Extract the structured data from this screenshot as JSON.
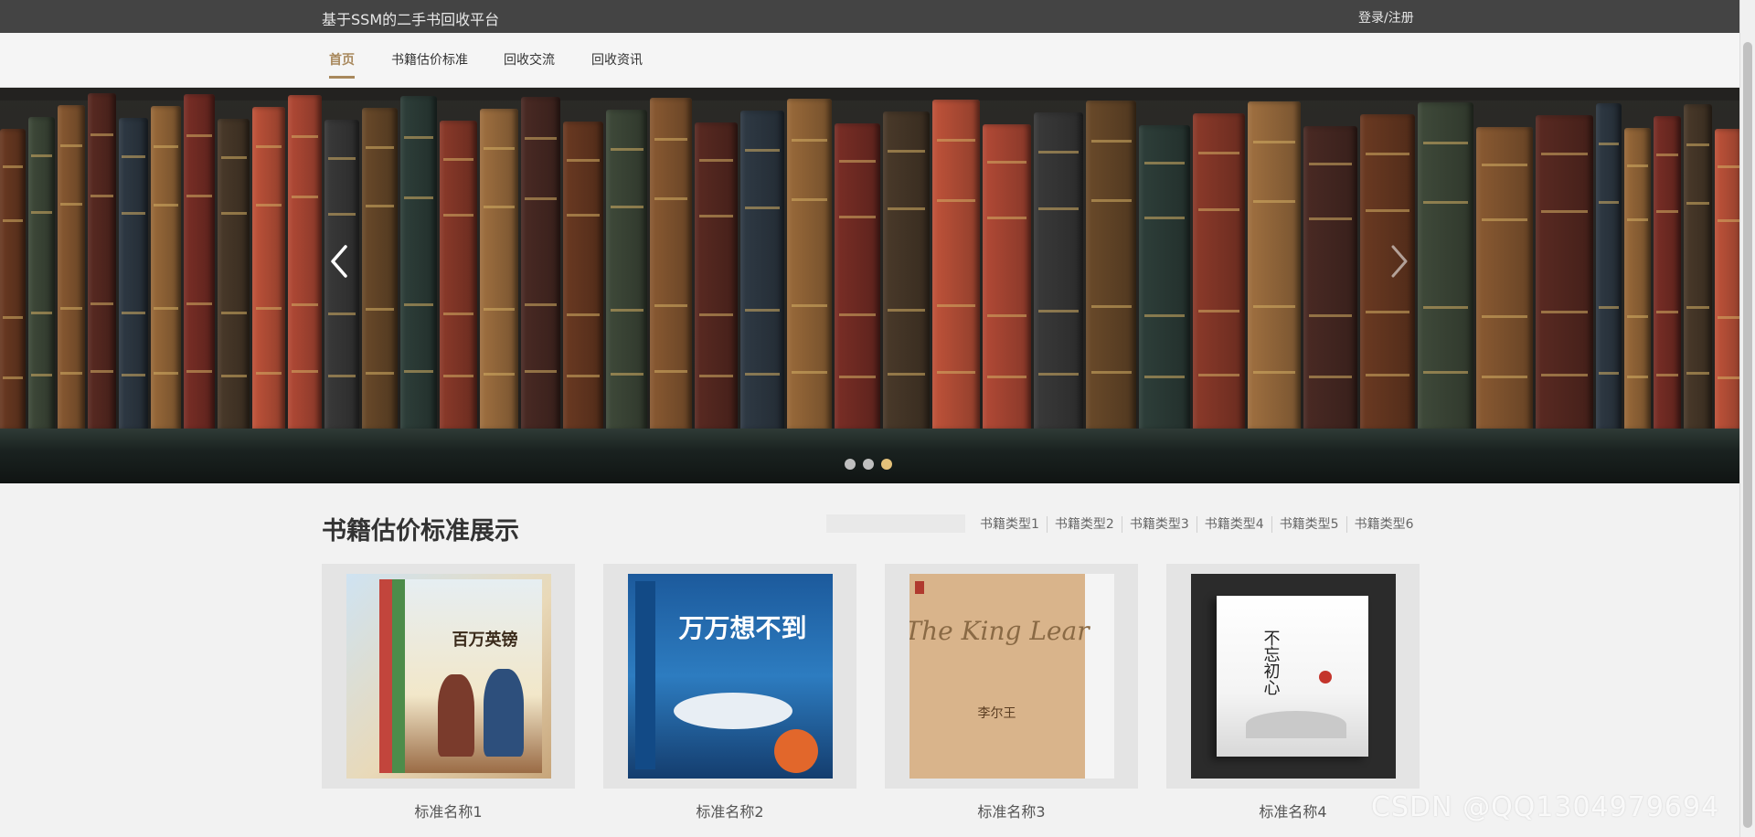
{
  "header": {
    "site_title": "基于SSM的二手书回收平台",
    "login_label": "登录/注册"
  },
  "nav": {
    "items": [
      {
        "label": "首页",
        "active": true
      },
      {
        "label": "书籍估价标准",
        "active": false
      },
      {
        "label": "回收交流",
        "active": false
      },
      {
        "label": "回收资讯",
        "active": false
      }
    ]
  },
  "banner": {
    "icons": {
      "prev": "chevron-left-icon",
      "next": "chevron-right-icon"
    },
    "slides": 3,
    "active_slide": 3
  },
  "section": {
    "title": "书籍估价标准展示",
    "categories": [
      "书籍类型1",
      "书籍类型2",
      "书籍类型3",
      "书籍类型4",
      "书籍类型5",
      "书籍类型6"
    ]
  },
  "cards": [
    {
      "name": "标准名称1",
      "cover_text": "百万英镑"
    },
    {
      "name": "标准名称2",
      "cover_text": "万万想不到"
    },
    {
      "name": "标准名称3",
      "cover_text": "The King Lear",
      "cover_subtext": "李尔王"
    },
    {
      "name": "标准名称4",
      "cover_text": "不忘初心"
    }
  ],
  "watermark": "CSDN @QQ1304979694",
  "colors": {
    "accent": "#a8885c",
    "topbar": "#444444",
    "dot_active": "#e5c27a"
  }
}
